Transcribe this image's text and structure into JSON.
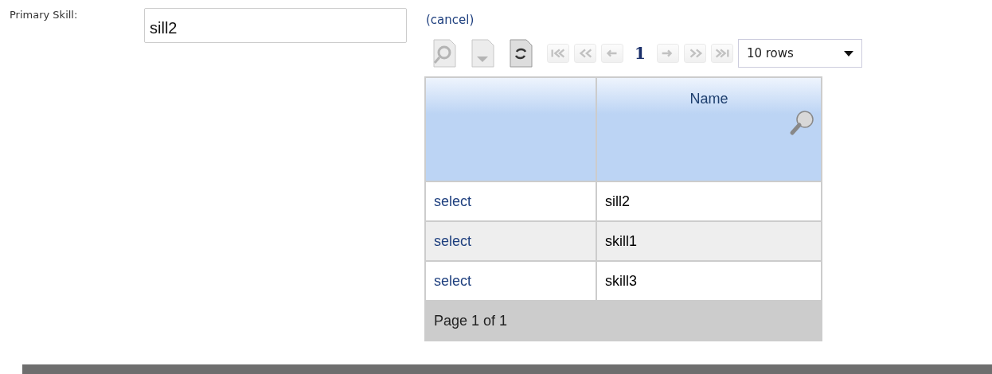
{
  "field": {
    "label": "Primary Skill:",
    "value": "sill2"
  },
  "cancel_link": "(cancel)",
  "toolbar": {
    "tools": [
      {
        "kind": "search-doc",
        "disabled": true
      },
      {
        "kind": "export-doc",
        "disabled": true
      },
      {
        "kind": "refresh-doc",
        "disabled": false
      }
    ],
    "pager": [
      {
        "kind": "first",
        "disabled": true
      },
      {
        "kind": "prev-page",
        "disabled": true
      },
      {
        "kind": "prev",
        "disabled": true
      },
      {
        "kind": "page",
        "label": "1"
      },
      {
        "kind": "next",
        "disabled": true
      },
      {
        "kind": "next-page",
        "disabled": true
      },
      {
        "kind": "last",
        "disabled": true
      }
    ],
    "rows_select": "10 rows"
  },
  "table": {
    "columns": [
      {
        "kind": "blank"
      },
      {
        "kind": "text",
        "label": "Name",
        "searchable": true
      }
    ],
    "rows": [
      {
        "action": "select",
        "name": "sill2"
      },
      {
        "action": "select",
        "name": "skill1"
      },
      {
        "action": "select",
        "name": "skill3"
      }
    ],
    "footer": "Page 1 of 1"
  }
}
